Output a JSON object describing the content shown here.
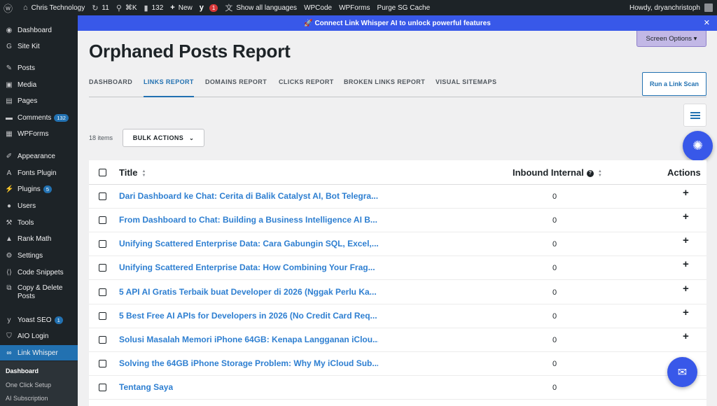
{
  "admin_bar": {
    "site_name": "Chris Technology",
    "updates_count": "11",
    "search_shortcut": "⌘K",
    "comments_count": "132",
    "new_label": "New",
    "yoast_count": "1",
    "languages_label": "Show all languages",
    "wpcode_label": "WPCode",
    "wpforms_label": "WPForms",
    "purge_label": "Purge SG Cache",
    "howdy": "Howdy, dryanchristoph"
  },
  "sidebar": {
    "items": [
      {
        "label": "Dashboard",
        "icon": "dashboard-icon"
      },
      {
        "label": "Site Kit",
        "icon": "sitekit-icon"
      },
      {
        "label": "Posts",
        "icon": "pin-icon"
      },
      {
        "label": "Media",
        "icon": "media-icon"
      },
      {
        "label": "Pages",
        "icon": "pages-icon"
      },
      {
        "label": "Comments",
        "icon": "comment-icon",
        "badge": "132"
      },
      {
        "label": "WPForms",
        "icon": "form-icon"
      },
      {
        "label": "Appearance",
        "icon": "brush-icon"
      },
      {
        "label": "Fonts Plugin",
        "icon": "font-icon"
      },
      {
        "label": "Plugins",
        "icon": "plugin-icon",
        "badge": "5"
      },
      {
        "label": "Users",
        "icon": "user-icon"
      },
      {
        "label": "Tools",
        "icon": "wrench-icon"
      },
      {
        "label": "Rank Math",
        "icon": "chart-icon"
      },
      {
        "label": "Settings",
        "icon": "settings-icon"
      },
      {
        "label": "Code Snippets",
        "icon": "code-icon"
      },
      {
        "label": "Copy & Delete Posts",
        "icon": "copy-icon"
      },
      {
        "label": "Yoast SEO",
        "icon": "yoast-icon",
        "badge": "1"
      },
      {
        "label": "AIO Login",
        "icon": "shield-icon"
      },
      {
        "label": "Link Whisper",
        "icon": "link-icon"
      }
    ],
    "submenu": [
      "Dashboard",
      "One Click Setup",
      "AI Subscription"
    ]
  },
  "banner": {
    "text": "🚀 Connect Link Whisper AI to unlock powerful features",
    "close": "✕"
  },
  "screen_options": "Screen Options ▾",
  "page_title": "Orphaned Posts Report",
  "tabs": [
    "DASHBOARD",
    "LINKS REPORT",
    "DOMAINS REPORT",
    "CLICKS REPORT",
    "BROKEN LINKS REPORT",
    "VISUAL SITEMAPS"
  ],
  "active_tab": "LINKS REPORT",
  "run_scan_label": "Run a Link Scan",
  "items_count": "18 items",
  "bulk_actions_label": "BULK ACTIONS",
  "table": {
    "columns": {
      "title": "Title",
      "inbound": "Inbound Internal",
      "actions": "Actions"
    },
    "rows": [
      {
        "title": "Dari Dashboard ke Chat: Cerita di Balik Catalyst AI, Bot Telegra...",
        "inbound": "0"
      },
      {
        "title": "From Dashboard to Chat: Building a Business Intelligence AI B...",
        "inbound": "0"
      },
      {
        "title": "Unifying Scattered Enterprise Data: Cara Gabungin SQL, Excel,...",
        "inbound": "0"
      },
      {
        "title": "Unifying Scattered Enterprise Data: How Combining Your Frag...",
        "inbound": "0"
      },
      {
        "title": "5 API AI Gratis Terbaik buat Developer di 2026 (Nggak Perlu Ka...",
        "inbound": "0"
      },
      {
        "title": "5 Best Free AI APIs for Developers in 2026 (No Credit Card Req...",
        "inbound": "0"
      },
      {
        "title": "Solusi Masalah Memori iPhone 64GB: Kenapa Langganan iClou...",
        "inbound": "0"
      },
      {
        "title": "Solving the 64GB iPhone Storage Problem: Why My iCloud Sub...",
        "inbound": "0"
      },
      {
        "title": "Tentang Saya",
        "inbound": "0"
      }
    ]
  },
  "colors": {
    "accent": "#2271b1",
    "banner": "#3858e9",
    "link": "#2e7fd1",
    "sidebar_bg": "#1d2327"
  }
}
